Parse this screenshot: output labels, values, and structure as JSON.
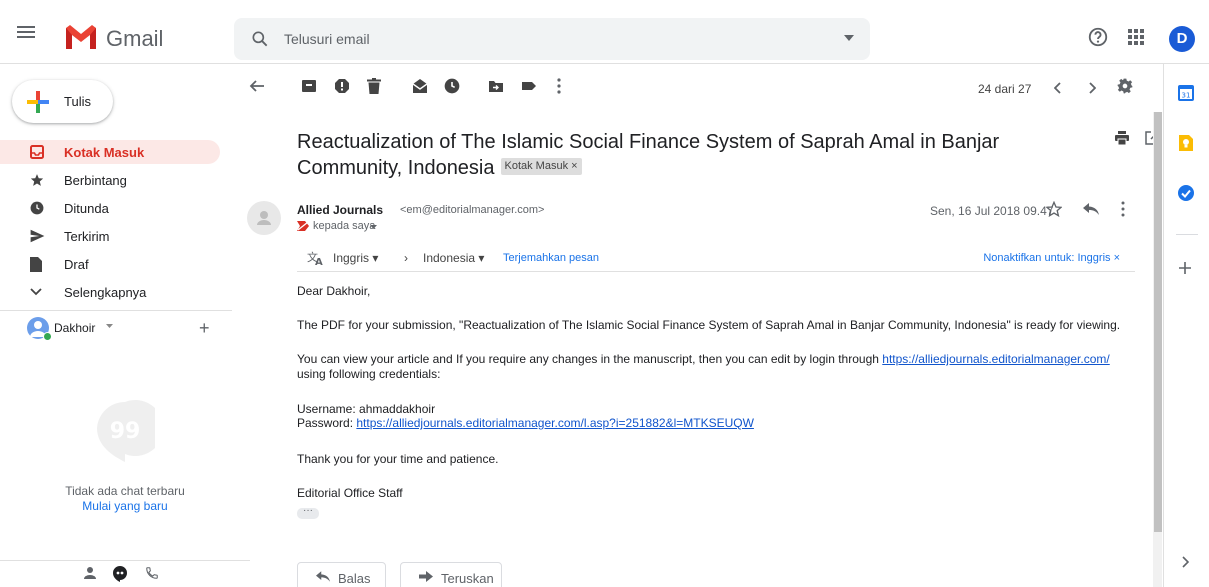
{
  "app": {
    "name": "Gmail"
  },
  "search": {
    "placeholder": "Telusuri email"
  },
  "account": {
    "initial": "D",
    "name": "Dakhoir",
    "avatar_color": "#1a5bd6"
  },
  "compose": {
    "label": "Tulis"
  },
  "nav": {
    "items": [
      {
        "label": "Kotak Masuk",
        "icon": "inbox-icon",
        "active": true
      },
      {
        "label": "Berbintang",
        "icon": "star-icon"
      },
      {
        "label": "Ditunda",
        "icon": "clock-icon"
      },
      {
        "label": "Terkirim",
        "icon": "send-icon"
      },
      {
        "label": "Draf",
        "icon": "draft-icon"
      },
      {
        "label": "Selengkapnya",
        "icon": "chevron-down-icon"
      }
    ]
  },
  "chat": {
    "empty_text": "Tidak ada chat terbaru",
    "start_link": "Mulai yang baru"
  },
  "toolbar": {
    "pager": "24 dari 27"
  },
  "email": {
    "subject": "Reactualization of The Islamic Social Finance System of Saprah Amal in Banjar Community, Indonesia",
    "label": "Kotak Masuk ×",
    "sender_name": "Allied Journals",
    "sender_email": "<em@editorialmanager.com>",
    "to": "kepada saya",
    "date": "Sen, 16 Jul 2018 09.47",
    "translate": {
      "from": "Inggris",
      "arrow": "›",
      "to": "Indonesia",
      "link": "Terjemahkan pesan",
      "disable": "Nonaktifkan untuk: Inggris"
    },
    "body": {
      "greeting": "Dear  Dakhoir,",
      "para1": "The PDF for your submission, \"Reactualization of The Islamic Social Finance System of Saprah Amal in Banjar Community, Indonesia\" is ready for viewing.",
      "para2_before": "You can view your article and If you require any changes in the manuscript, then you can edit by login through",
      "para2_link": "https://alliedjournals.editorialmanager.com/",
      "para2_after": "using following credentials:",
      "username": "Username: ahmaddakhoir",
      "password_label": "Password:",
      "password_link": "https://alliedjournals.editorialmanager.com/l.asp?i=251882&l=MTKSEUQW",
      "thanks": "Thank you for your time and patience.",
      "signature": "Editorial Office Staff"
    }
  },
  "actions": {
    "reply": "Balas",
    "forward": "Teruskan"
  },
  "colors": {
    "accent_red": "#d93025",
    "active_bg": "#fce8e6",
    "link_blue": "#1a73e8"
  }
}
